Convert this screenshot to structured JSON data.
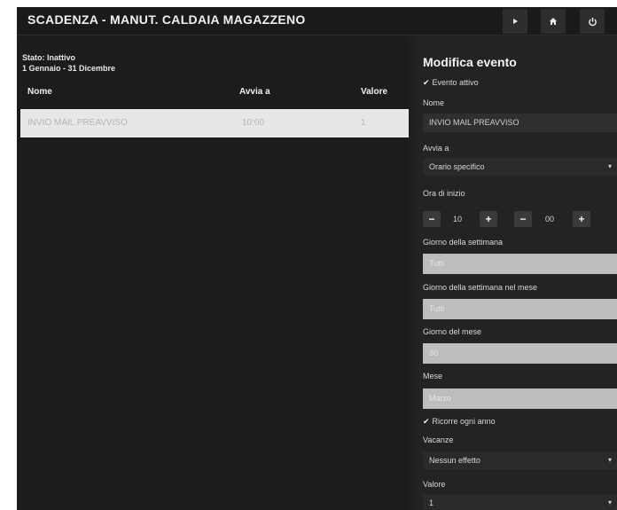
{
  "window": {
    "title": "SCADENZA - MANUT. CALDAIA MAGAZZENO",
    "icons": [
      "play-icon",
      "home-icon",
      "power-icon"
    ]
  },
  "list": {
    "stato": "Stato: Inattivo",
    "periodo": "1 Gennaio - 31 Dicembre",
    "columns": [
      "Nome",
      "Avvia a",
      "Valore"
    ],
    "rows": [
      {
        "nome": "INVIO MAIL PREAVVISO",
        "avvia_a": "10:00",
        "valore": "1"
      }
    ]
  },
  "editor": {
    "title": "Modifica evento",
    "evento_attivo": "Evento attivo",
    "nome_label": "Nome",
    "nome_value": "INVIO MAIL PREAVVISO",
    "avvia_label": "Avvia a",
    "avvia_value": "Orario specifico",
    "ora_label": "Ora di inizio",
    "ora_hour": "10",
    "ora_minute": "00",
    "giorno_settimana_label": "Giorno della settimana",
    "giorno_settimana_value": "Tutti",
    "giorno_settimana_mese_label": "Giorno della settimana nel mese",
    "giorno_settimana_mese_value": "Tutti",
    "giorno_mese_label": "Giorno del mese",
    "giorno_mese_value": "30",
    "mese_label": "Mese",
    "mese_value": "Marzo",
    "ricorre_label": "Ricorre ogni anno",
    "vacanze_label": "Vacanze",
    "vacanze_value": "Nessun effetto",
    "valore_label": "Valore",
    "valore_value": "1"
  }
}
